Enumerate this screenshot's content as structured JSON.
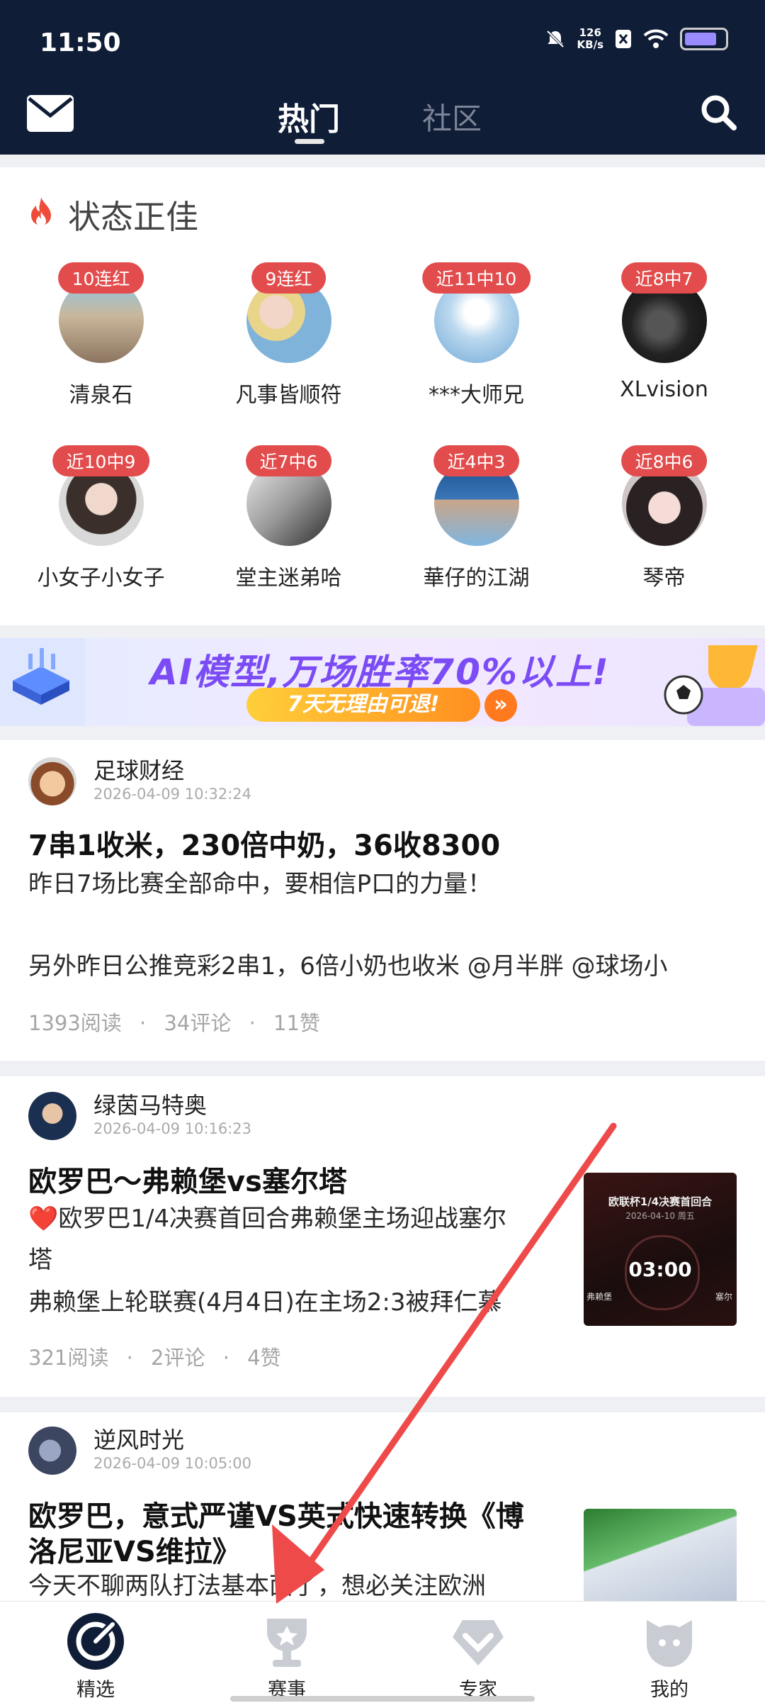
{
  "status": {
    "time": "11:50",
    "speed_value": "126",
    "speed_unit": "KB/s"
  },
  "header": {
    "tab_hot": "热门",
    "tab_community": "社区"
  },
  "hot_section": {
    "title": "状态正佳",
    "people": [
      {
        "badge": "10连红",
        "name": "清泉石"
      },
      {
        "badge": "9连红",
        "name": "凡事皆顺符"
      },
      {
        "badge": "近11中10",
        "name": "***大师兄"
      },
      {
        "badge": "近8中7",
        "name": "XLvision"
      },
      {
        "badge": "近10中9",
        "name": "小女子小女子"
      },
      {
        "badge": "近7中6",
        "name": "堂主迷弟哈"
      },
      {
        "badge": "近4中3",
        "name": "華仔的江湖"
      },
      {
        "badge": "近8中6",
        "name": "琴帝"
      }
    ]
  },
  "banner": {
    "headline": "AI模型,万场胜率70%以上!",
    "button": "7天无理由可退!",
    "arrow": "»"
  },
  "posts": [
    {
      "author": "足球财经",
      "date": "2026-04-09 10:32:24",
      "title": "7串1收米，230倍中奶，36收8300",
      "line1": "昨日7场比赛全部命中，要相信P口的力量！",
      "line2": "另外昨日公推竞彩2串1，6倍小奶也收米 @月半胖  @球场小",
      "reads": "1393阅读",
      "comments": "34评论",
      "likes": "11赞"
    },
    {
      "author": "绿茵马特奥",
      "date": "2026-04-09 10:16:23",
      "title": "欧罗巴～弗赖堡vs塞尔塔",
      "line1": "❤️欧罗巴1/4决赛首回合弗赖堡主场迎战塞尔",
      "line2": "塔",
      "line3": " 弗赖堡上轮联赛(4月4日)在主场2:3被拜仁慕",
      "reads": "321阅读",
      "comments": "2评论",
      "likes": "4赞",
      "thumb_title": "欧联杯1/4决赛首回合",
      "thumb_date": "2026-04-10 周五",
      "thumb_time": "03:00",
      "thumb_left": "弗赖堡",
      "thumb_right": "塞尔"
    },
    {
      "author": "逆风时光",
      "date": "2026-04-09 10:05:00",
      "title_line1": "欧罗巴，意式严谨VS英式快速转换《博",
      "title_line2": "洛尼亚VS维拉》",
      "line1": "今天不聊两队打法基本面了，想必关注欧洲"
    }
  ],
  "meta_sep": "·",
  "bottom_nav": [
    {
      "label": "精选",
      "icon": "featured-icon"
    },
    {
      "label": "赛事",
      "icon": "trophy-icon"
    },
    {
      "label": "专家",
      "icon": "expert-icon"
    },
    {
      "label": "我的",
      "icon": "profile-icon"
    }
  ],
  "colors": {
    "header_bg": "#0f1d36",
    "badge_red": "#e24c4c",
    "accent_orange": "#ff8f1f"
  }
}
